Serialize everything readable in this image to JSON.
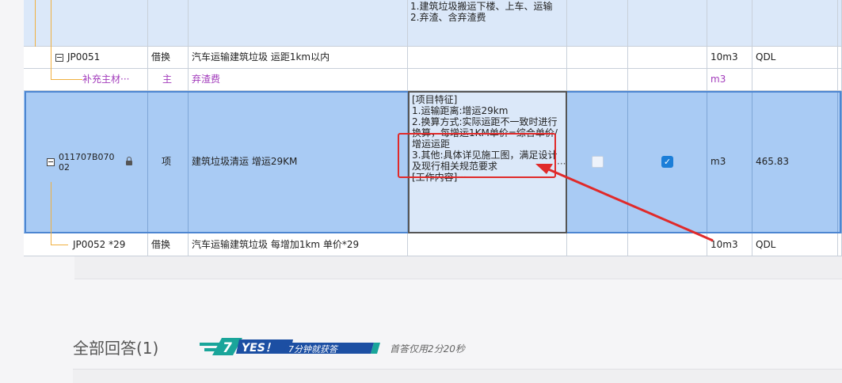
{
  "rows": {
    "top": {
      "features": "1.建筑垃圾搬运下楼、上车、运输\n2.弃渣、含弃渣费"
    },
    "jp0051": {
      "code": "JP0051",
      "category": "借换",
      "name": "汽车运输建筑垃圾 运距1km以内",
      "unit": "10m3",
      "qty": "QDL"
    },
    "supplement": {
      "code": "补充主材···",
      "category": "主",
      "name": "弃渣费",
      "unit": "m3"
    },
    "selected": {
      "code_line1": "011707B070",
      "code_line2": "02",
      "category": "项",
      "name": "建筑垃圾清运 增运29KM",
      "features": "[项目特征]\n1.运输距离:增运29km\n2.换算方式:实际运距不一致时进行换算，每增运1KM单价=综合单价/增运运距\n3.其他:具体详见施工图，满足设计及现行相关规范要求\n[工作内容]···",
      "more": "···",
      "check_a": false,
      "check_b": true,
      "check_mark": "✓",
      "unit": "m3",
      "qty": "465.83"
    },
    "jp0052": {
      "code": "JP0052 *29",
      "category": "借换",
      "name": "汽车运输建筑垃圾 每增加1km  单价*29",
      "unit": "10m3",
      "qty": "QDL"
    }
  },
  "answers": {
    "title": "全部回答(1)",
    "badge_text": "YES！7分钟就获答",
    "badge_number": "7",
    "badge_yes": "YES！",
    "badge_tail": "7分钟就获答",
    "quick_note": "首答仅用2分20秒"
  },
  "colors": {
    "selected_row": "#a9cbf4",
    "header_row": "#dbe8f9",
    "annotation_red": "#e02a2a",
    "badge_teal": "#1aa59a",
    "badge_navy": "#1c4fa3",
    "checkbox_on": "#1b7ed8"
  }
}
